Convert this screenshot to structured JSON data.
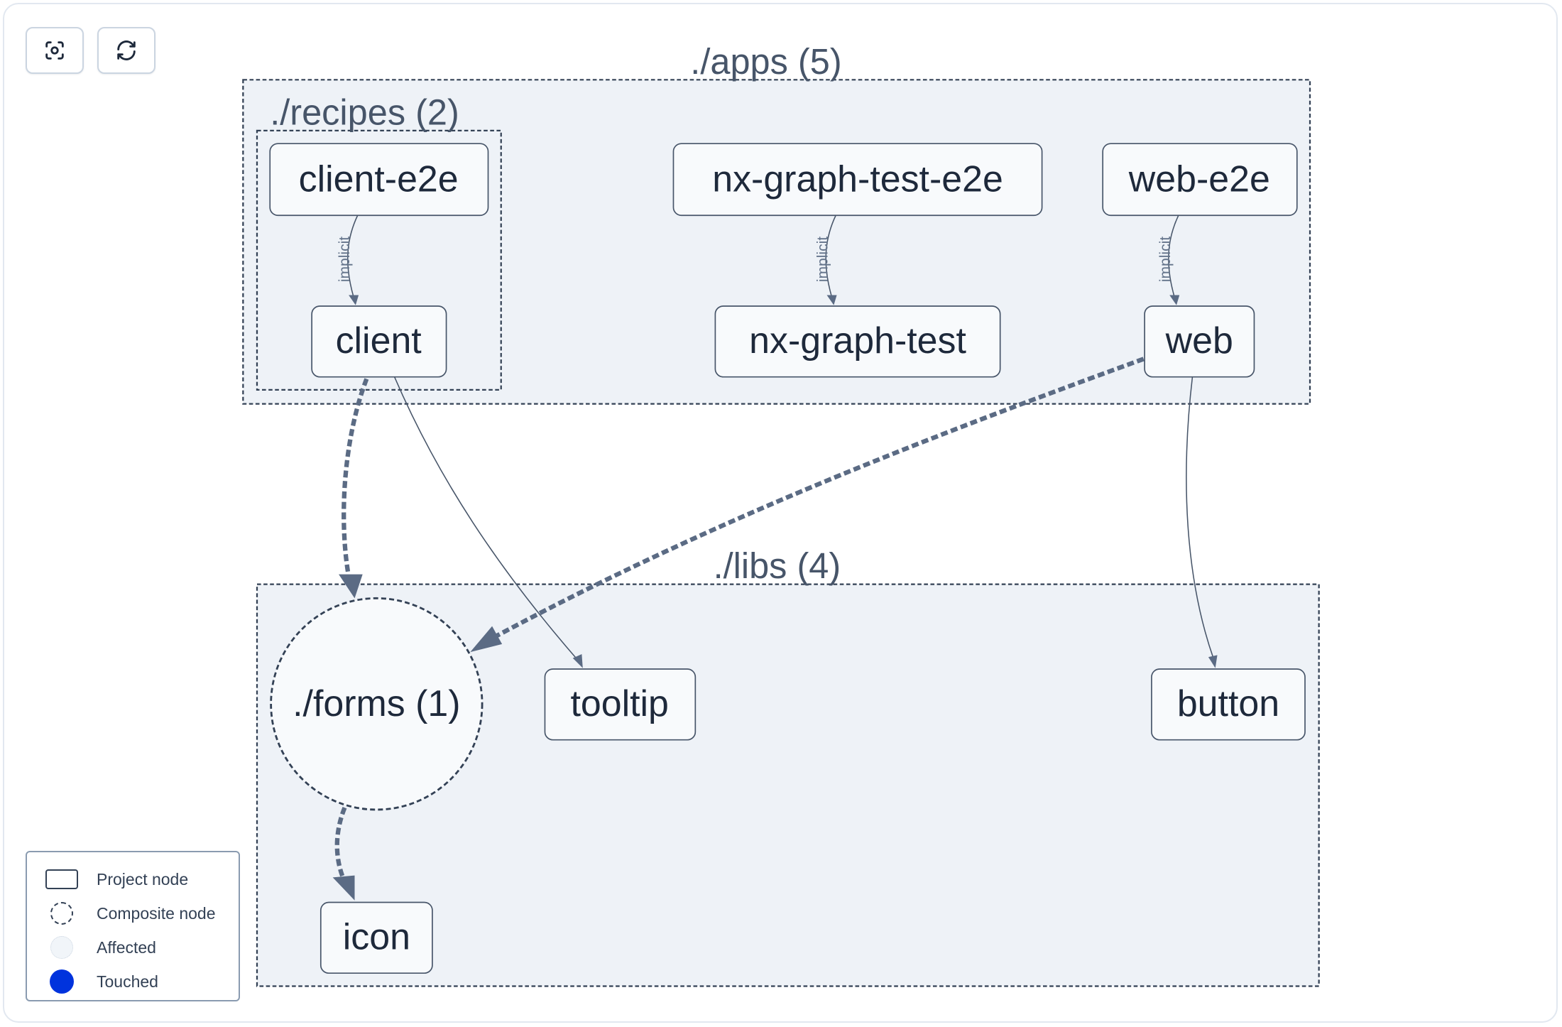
{
  "toolbar": {
    "buttons": [
      {
        "name": "focus-button",
        "icon": "focus-scan-icon"
      },
      {
        "name": "reset-button",
        "icon": "refresh-icon"
      }
    ]
  },
  "groups": {
    "apps": {
      "label": "./apps (5)"
    },
    "recipes": {
      "label": "./recipes (2)"
    },
    "libs": {
      "label": "./libs (4)"
    }
  },
  "nodes": {
    "client_e2e": {
      "label": "client-e2e",
      "type": "project"
    },
    "client": {
      "label": "client",
      "type": "project"
    },
    "nx_graph_test_e2e": {
      "label": "nx-graph-test-e2e",
      "type": "project"
    },
    "nx_graph_test": {
      "label": "nx-graph-test",
      "type": "project"
    },
    "web_e2e": {
      "label": "web-e2e",
      "type": "project"
    },
    "web": {
      "label": "web",
      "type": "project"
    },
    "forms": {
      "label": "./forms (1)",
      "type": "composite"
    },
    "tooltip": {
      "label": "tooltip",
      "type": "project"
    },
    "button": {
      "label": "button",
      "type": "project"
    },
    "icon": {
      "label": "icon",
      "type": "project"
    }
  },
  "edges": [
    {
      "from": "client-e2e",
      "to": "client",
      "label": "implicit",
      "style": "thin"
    },
    {
      "from": "nx-graph-test-e2e",
      "to": "nx-graph-test",
      "label": "implicit",
      "style": "thin"
    },
    {
      "from": "web-e2e",
      "to": "web",
      "label": "implicit",
      "style": "thin"
    },
    {
      "from": "client",
      "to": "./forms (1)",
      "label": "",
      "style": "dashed-composite"
    },
    {
      "from": "client",
      "to": "tooltip",
      "label": "",
      "style": "thin"
    },
    {
      "from": "web",
      "to": "./forms (1)",
      "label": "",
      "style": "dashed-composite"
    },
    {
      "from": "web",
      "to": "button",
      "label": "",
      "style": "thin"
    },
    {
      "from": "./forms (1)",
      "to": "icon",
      "label": "",
      "style": "dashed-composite"
    }
  ],
  "edge_labels": {
    "implicit": "implicit"
  },
  "legend": {
    "items": [
      {
        "label": "Project node",
        "symbol": "rounded-rect"
      },
      {
        "label": "Composite node",
        "symbol": "dashed-circle"
      },
      {
        "label": "Affected",
        "symbol": "light-circle"
      },
      {
        "label": "Touched",
        "symbol": "filled-circle"
      }
    ],
    "touched_color": "#0033dd"
  }
}
